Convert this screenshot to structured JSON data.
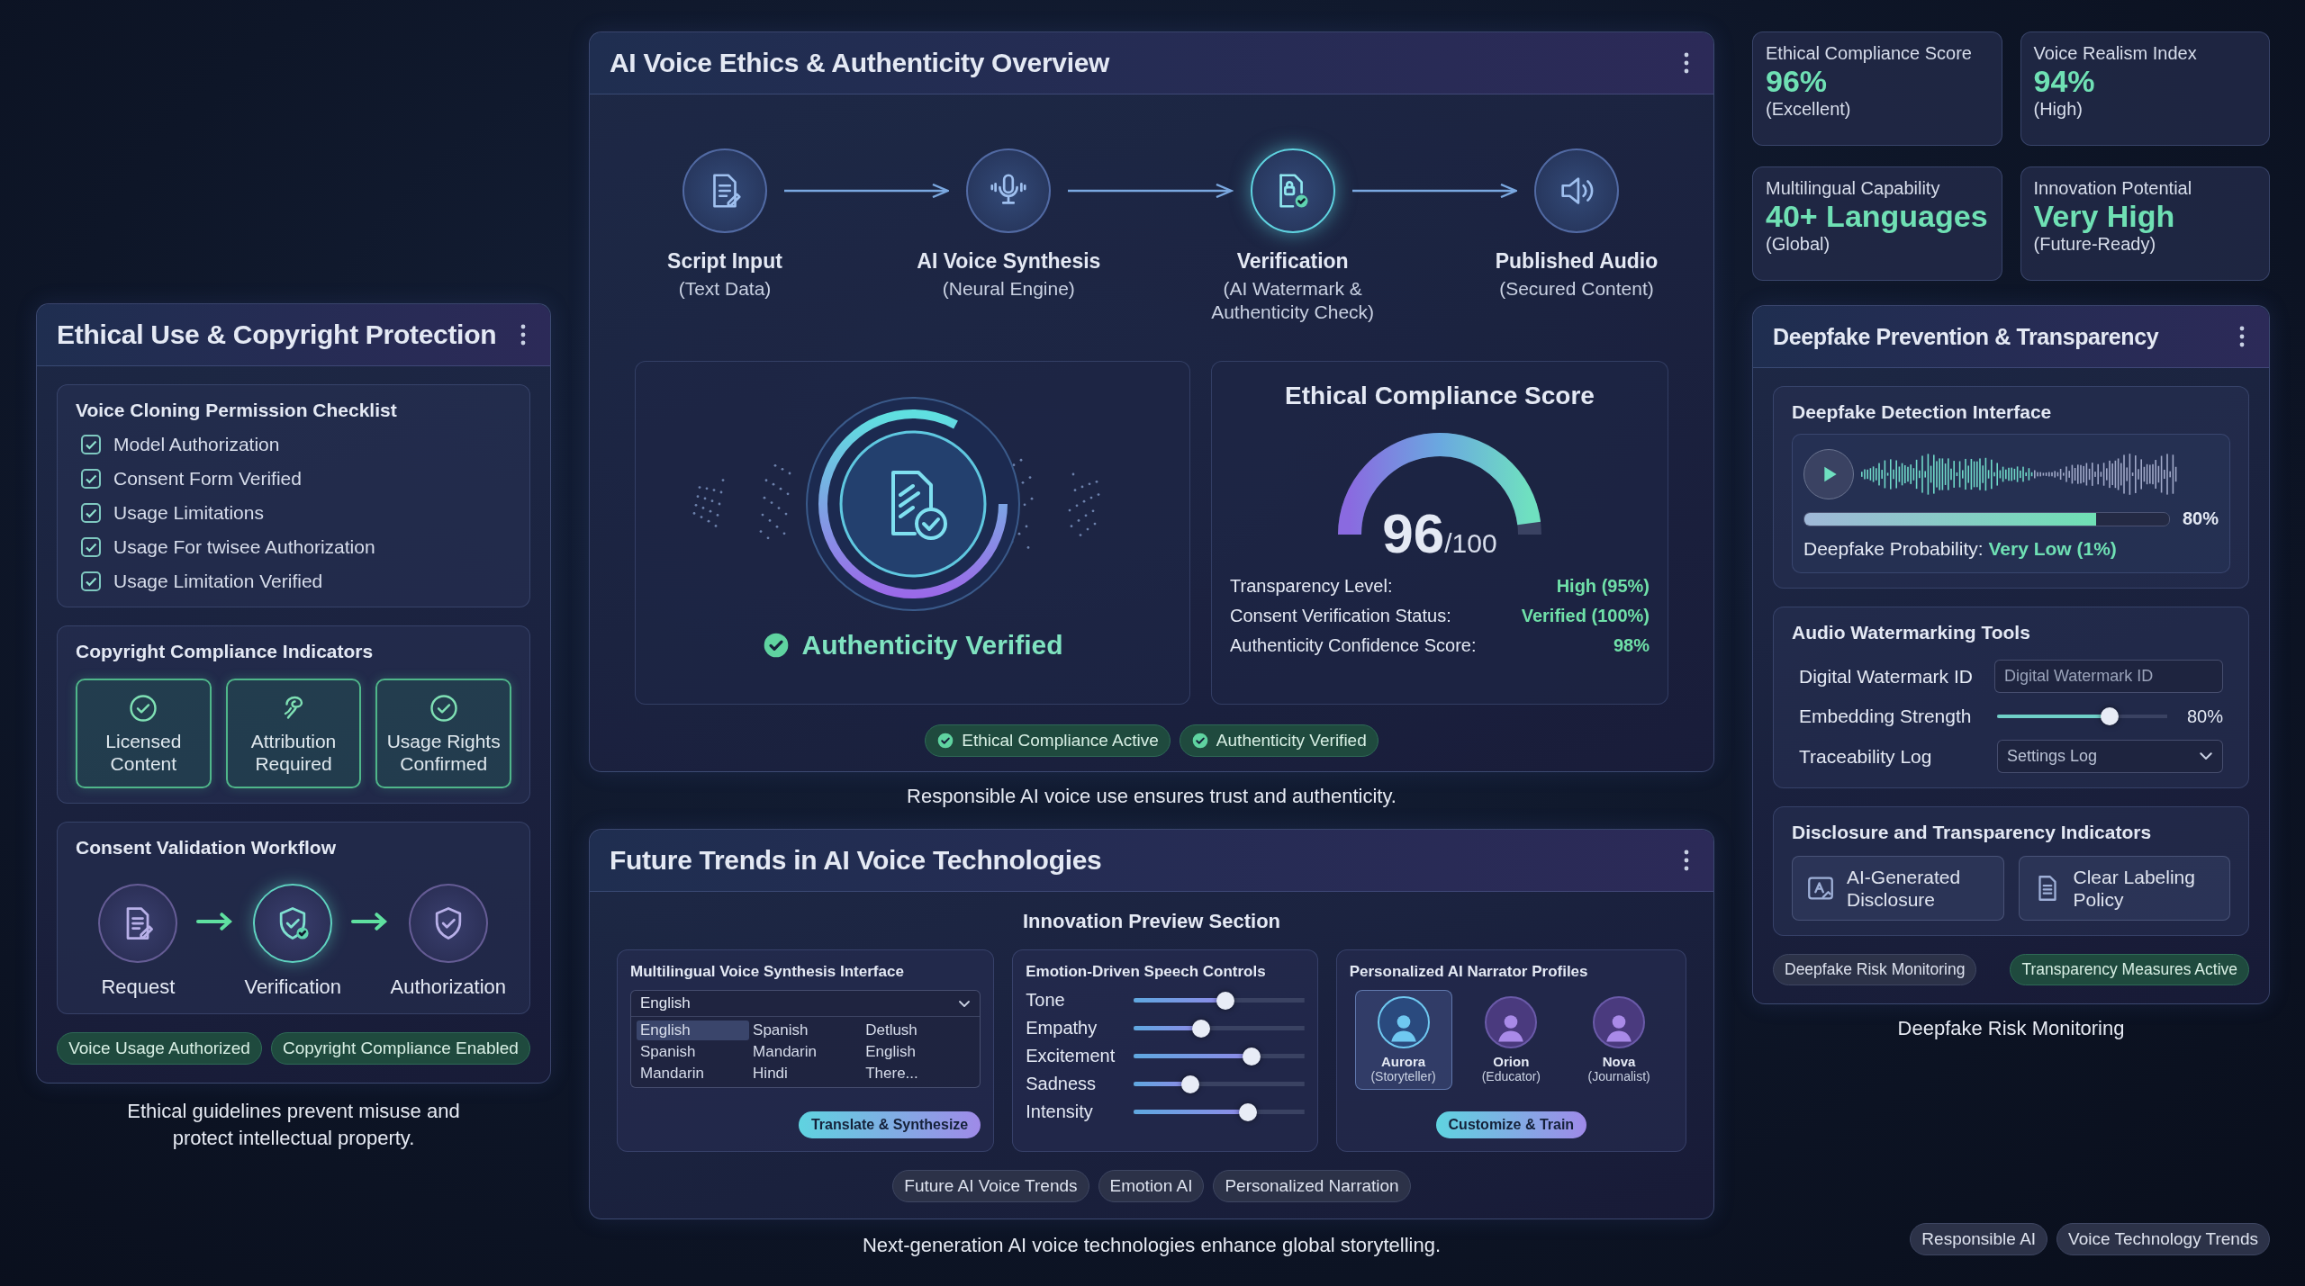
{
  "ethics": {
    "title": "Ethical Use & Copyright Protection",
    "checklist": {
      "title": "Voice Cloning Permission Checklist",
      "items": [
        {
          "label": "Model Authorization",
          "checked": true
        },
        {
          "label": "Consent Form Verified",
          "checked": true
        },
        {
          "label": "Usage Limitations",
          "checked": true
        },
        {
          "label": "Usage For twisee Authorization",
          "checked": true
        },
        {
          "label": "Usage Limitation Verified",
          "checked": true
        }
      ]
    },
    "copyright": {
      "title": "Copyright Compliance Indicators",
      "indicators": [
        {
          "label": "Licensed Content"
        },
        {
          "label": "Attribution Required"
        },
        {
          "label": "Usage Rights Confirmed"
        }
      ]
    },
    "workflow": {
      "title": "Consent Validation Workflow",
      "steps": [
        {
          "label": "Request",
          "selected": false
        },
        {
          "label": "Verification",
          "selected": true
        },
        {
          "label": "Authorization",
          "selected": false
        }
      ]
    },
    "tags": [
      "Voice Usage Authorized",
      "Copyright Compliance Enabled"
    ],
    "caption": "Ethical guidelines prevent misuse and protect intellectual property."
  },
  "overview": {
    "title": "AI Voice Ethics & Authenticity Overview",
    "pipeline": [
      {
        "title": "Script Input",
        "subtitle": "(Text Data)",
        "selected": false
      },
      {
        "title": "AI Voice Synthesis",
        "subtitle": "(Neural Engine)",
        "selected": false
      },
      {
        "title": "Verification",
        "subtitle": "(AI Watermark & Authenticity Check)",
        "selected": true
      },
      {
        "title": "Published Audio",
        "subtitle": "(Secured Content)",
        "selected": false
      }
    ],
    "authenticity": "Authenticity Verified",
    "score": {
      "title": "Ethical Compliance Score",
      "value": "96",
      "max": "/100",
      "level": 0.96,
      "rows": [
        {
          "label": "Transparency Level:",
          "value": "High (95%)"
        },
        {
          "label": "Consent Verification Status:",
          "value": "Verified (100%)"
        },
        {
          "label": "Authenticity Confidence Score:",
          "value": "98%"
        }
      ]
    },
    "tags": [
      "Ethical Compliance Active",
      "Authenticity Verified"
    ],
    "caption": "Responsible AI voice use ensures trust and authenticity."
  },
  "trends": {
    "title": "Future Trends in AI Voice Technologies",
    "section_title": "Innovation Preview Section",
    "multilingual": {
      "title": "Multilingual Voice Synthesis Interface",
      "select": "English",
      "options": [
        {
          "label": "English",
          "selected": true
        },
        {
          "label": "Spanish",
          "selected": false
        },
        {
          "label": "Detlush",
          "selected": false
        },
        {
          "label": "Spanish",
          "selected": false
        },
        {
          "label": "Mandarin",
          "selected": false
        },
        {
          "label": "English",
          "selected": false
        },
        {
          "label": "Mandarin",
          "selected": false
        },
        {
          "label": "Hindi",
          "selected": false
        },
        {
          "label": "There...",
          "selected": false
        }
      ],
      "button": "Translate & Synthesize"
    },
    "emotion": {
      "title": "Emotion-Driven Speech Controls",
      "sliders": [
        {
          "label": "Tone",
          "level": 0.54
        },
        {
          "label": "Empathy",
          "level": 0.38
        },
        {
          "label": "Excitement",
          "level": 0.71
        },
        {
          "label": "Sadness",
          "level": 0.31
        },
        {
          "label": "Intensity",
          "level": 0.69
        }
      ]
    },
    "narrators": {
      "title": "Personalized AI Narrator Profiles",
      "profiles": [
        {
          "name": "Aurora",
          "role": "(Storyteller)",
          "selected": true
        },
        {
          "name": "Orion",
          "role": "(Educator)",
          "selected": false
        },
        {
          "name": "Nova",
          "role": "(Journalist)",
          "selected": false
        }
      ],
      "button": "Customize & Train"
    },
    "tags": [
      "Future AI Voice Trends",
      "Emotion AI",
      "Personalized Narration"
    ],
    "caption": "Next-generation AI voice technologies enhance global storytelling."
  },
  "stats": [
    {
      "label": "Ethical Compliance Score",
      "value": "96%",
      "note": "(Excellent)"
    },
    {
      "label": "Voice Realism Index",
      "value": "94%",
      "note": "(High)"
    },
    {
      "label": "Multilingual Capability",
      "value": "40+ Languages",
      "note": "(Global)"
    },
    {
      "label": "Innovation Potential",
      "value": "Very High",
      "note": "(Future-Ready)"
    }
  ],
  "deepfake": {
    "title": "Deepfake Prevention & Transparency",
    "detection": {
      "title": "Deepfake Detection Interface",
      "level": 0.8,
      "reading": "80%",
      "probability_label": "Deepfake Probability:",
      "probability_value": "Very Low (1%)"
    },
    "watermark": {
      "title": "Audio Watermarking Tools",
      "id_label": "Digital Watermark ID",
      "id_placeholder": "Digital Watermark ID",
      "strength_label": "Embedding Strength",
      "level": 0.68,
      "strength_reading": "80%",
      "log_label": "Traceability Log",
      "log_value": "Settings Log"
    },
    "disclosure": {
      "title": "Disclosure and Transparency Indicators",
      "items": [
        "AI-Generated Disclosure",
        "Clear Labeling Policy"
      ]
    },
    "tags": [
      {
        "label": "Deepfake Risk Monitoring",
        "active": false
      },
      {
        "label": "Transparency Measures Active",
        "active": true
      }
    ],
    "caption": "Deepfake Risk Monitoring"
  },
  "footer_tags": [
    "Responsible AI",
    "Voice Technology Trends"
  ]
}
